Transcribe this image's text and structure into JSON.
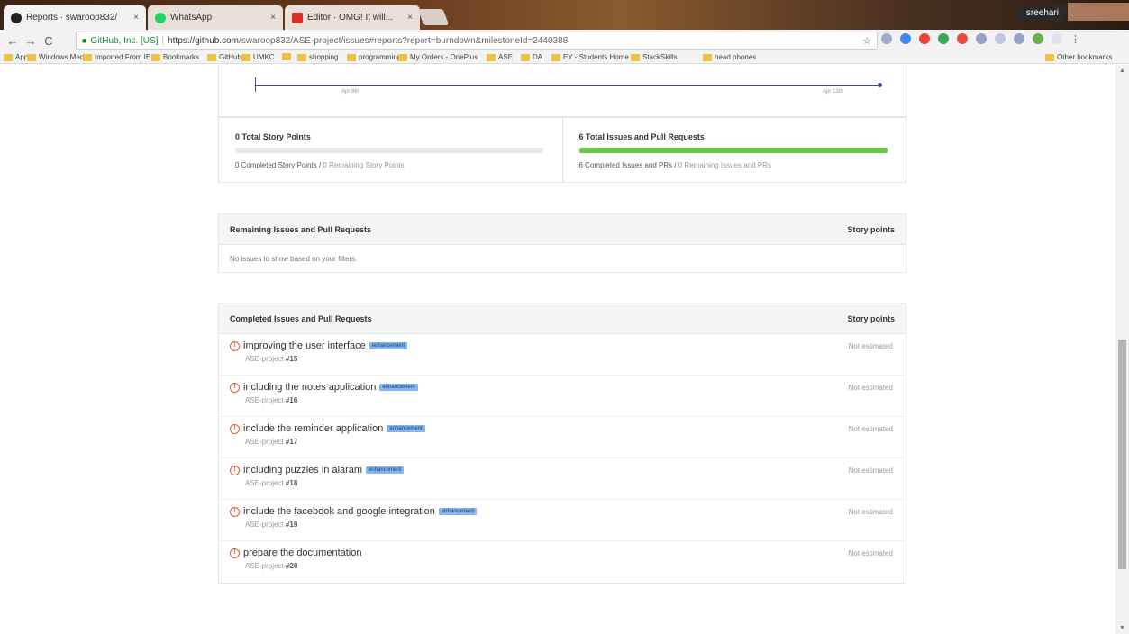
{
  "browser": {
    "tabs": [
      {
        "title": "Reports · swaroop832/",
        "favicon_color": "#222222"
      },
      {
        "title": "WhatsApp",
        "favicon_color": "#25d366"
      },
      {
        "title": "Editor · OMG! It will...",
        "favicon_color": "#d93025"
      }
    ],
    "user": "sreehari",
    "url_secure_label": "GitHub, Inc. [US]",
    "url_host": "https://github.com",
    "url_path": "/swaroop832/ASE-project/issues#reports?report=burndown&milestoneId=2440388",
    "bookmarks": [
      "Apps",
      "Windows Media",
      "Imported From IE",
      "Bookmarks",
      "GitHub",
      "UMKC",
      "",
      "shopping",
      "programming",
      "My Orders - OnePlus",
      "ASE",
      "DA",
      "EY - Students Home",
      "StackSkills",
      "head phones"
    ],
    "other_bookmarks": "Other bookmarks"
  },
  "burndown": {
    "ticks": [
      "Apr 9th",
      "Apr 13th"
    ]
  },
  "summary": {
    "story": {
      "title": "0 Total Story Points",
      "progress": 0,
      "completed": "0 Completed Story Points",
      "separator": " / ",
      "remaining": "0 Remaining Story Points"
    },
    "issues": {
      "title": "6 Total Issues and Pull Requests",
      "progress": 1,
      "completed": "6 Completed Issues and PRs",
      "separator": " / ",
      "remaining": "0 Remaining Issues and PRs"
    }
  },
  "remaining": {
    "header": "Remaining Issues and Pull Requests",
    "points_header": "Story points",
    "empty": "No issues to show based on your filters."
  },
  "completed": {
    "header": "Completed Issues and Pull Requests",
    "points_header": "Story points",
    "issues": [
      {
        "title": "improving the user interface",
        "label": "enhancement",
        "repo": "ASE-project",
        "number": "#15",
        "estimate": "Not estimated"
      },
      {
        "title": "including the notes application",
        "label": "enhancement",
        "repo": "ASE-project",
        "number": "#16",
        "estimate": "Not estimated"
      },
      {
        "title": "include the reminder application",
        "label": "enhancement",
        "repo": "ASE-project",
        "number": "#17",
        "estimate": "Not estimated"
      },
      {
        "title": "including puzzles in alaram",
        "label": "enhancement",
        "repo": "ASE-project",
        "number": "#18",
        "estimate": "Not estimated"
      },
      {
        "title": "include the facebook and google integration",
        "label": "enhancement",
        "repo": "ASE-project",
        "number": "#19",
        "estimate": "Not estimated"
      },
      {
        "title": "prepare the documentation",
        "label": "",
        "repo": "ASE-project",
        "number": "#20",
        "estimate": "Not estimated"
      }
    ]
  },
  "colors": {
    "progress_fill": "#6cc644",
    "label_bg": "#84b6eb",
    "issue_icon": "#e15a2f",
    "axis": "#3b4ba0"
  }
}
